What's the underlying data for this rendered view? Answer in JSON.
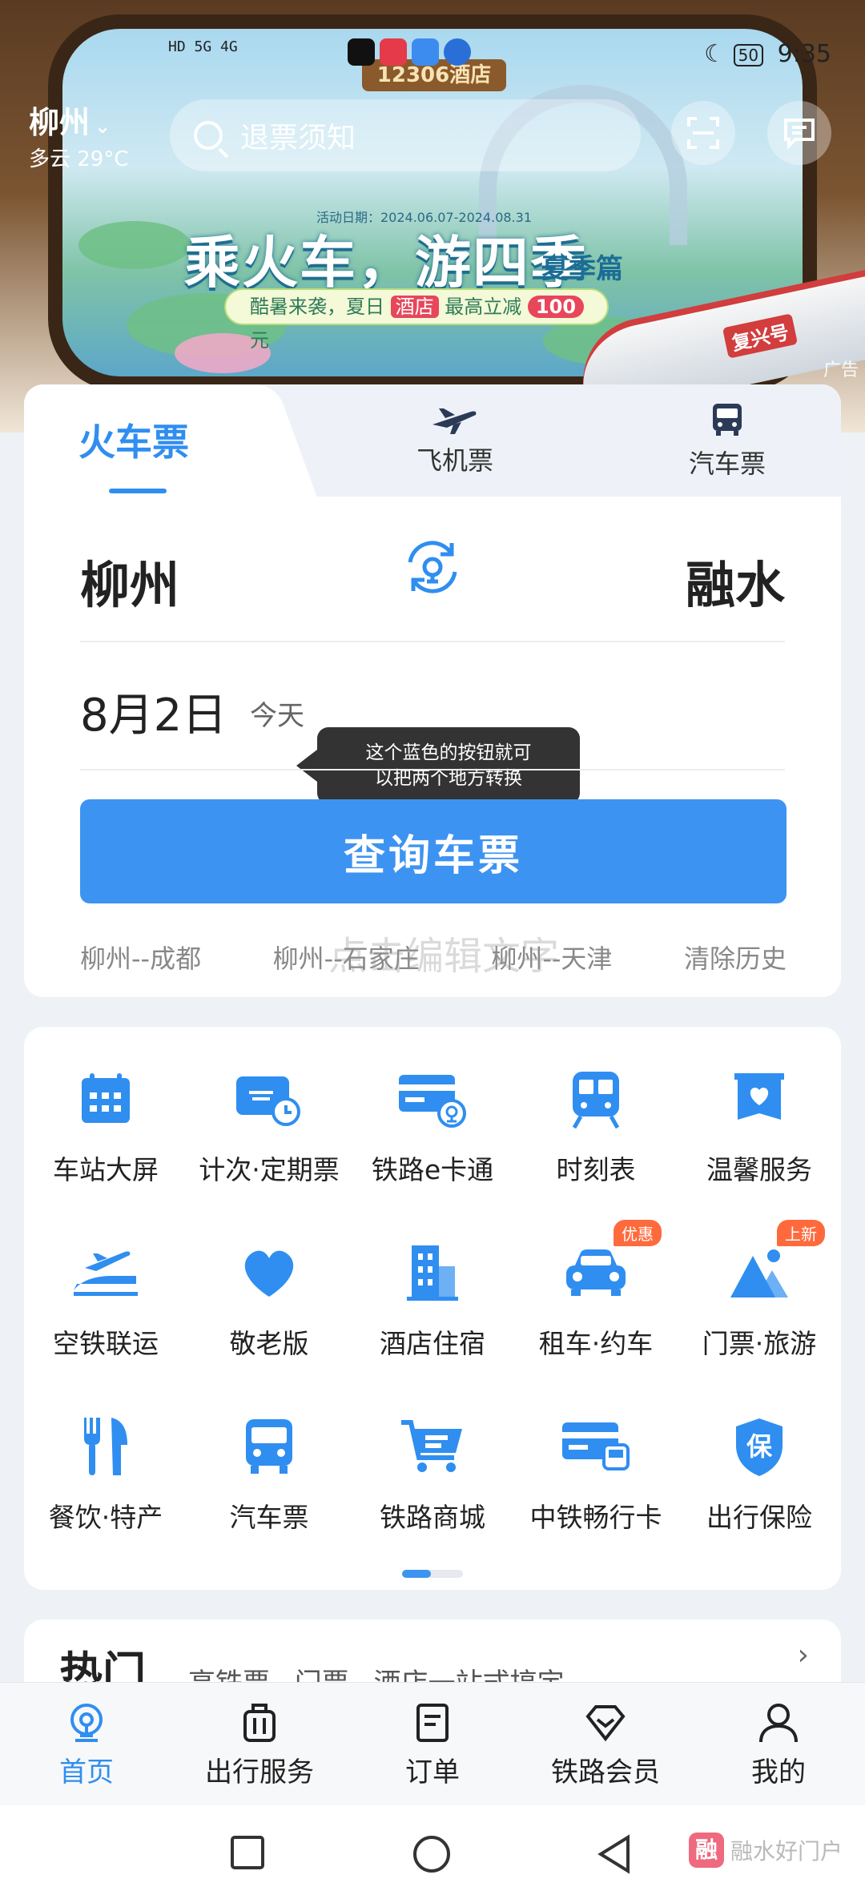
{
  "status_bar": {
    "signal": "HD 5G 4G",
    "time": "9:35",
    "battery": "50"
  },
  "header": {
    "city": "柳州",
    "weather": "多云 29°C",
    "search_placeholder": "退票须知"
  },
  "banner": {
    "sign": "12306酒店",
    "date_range": "活动日期：2024.06.07-2024.08.31",
    "title": "乘火车，游四季",
    "subtitle": "夏季篇",
    "pill_prefix": "酷暑来袭，夏日",
    "pill_hotel": "酒店",
    "pill_mid": "最高立减",
    "pill_amount": "100",
    "pill_unit": "元",
    "train_label": "复兴号",
    "ad_tag": "广告"
  },
  "tabs": {
    "train": "火车票",
    "flight": "飞机票",
    "bus": "汽车票"
  },
  "ticket": {
    "from": "柳州",
    "to": "融水",
    "date": "8月2日",
    "date_hint": "今天",
    "tooltip_line1": "这个蓝色的按钮就可",
    "tooltip_line2": "以把两个地方转换",
    "query_button": "查询车票",
    "history": [
      "柳州--成都",
      "柳州--石家庄",
      "柳州--天津",
      "清除历史"
    ],
    "watermark": "点击编辑文字"
  },
  "services": [
    {
      "label": "车站大屏",
      "icon": "calendar-icon"
    },
    {
      "label": "计次·定期票",
      "icon": "ticket-clock-icon"
    },
    {
      "label": "铁路e卡通",
      "icon": "rail-card-icon"
    },
    {
      "label": "时刻表",
      "icon": "train-front-icon"
    },
    {
      "label": "温馨服务",
      "icon": "heart-box-icon"
    },
    {
      "label": "空铁联运",
      "icon": "plane-train-icon"
    },
    {
      "label": "敬老版",
      "icon": "heart-icon"
    },
    {
      "label": "酒店住宿",
      "icon": "building-icon"
    },
    {
      "label": "租车·约车",
      "icon": "car-icon",
      "badge": "优惠"
    },
    {
      "label": "门票·旅游",
      "icon": "mountain-icon",
      "badge": "上新"
    },
    {
      "label": "餐饮·特产",
      "icon": "fork-knife-icon"
    },
    {
      "label": "汽车票",
      "icon": "bus-icon"
    },
    {
      "label": "铁路商城",
      "icon": "cart-icon"
    },
    {
      "label": "中铁畅行卡",
      "icon": "card-train-icon"
    },
    {
      "label": "出行保险",
      "icon": "shield-insurance-icon",
      "glyph": "保"
    }
  ],
  "hot": {
    "title": "热门",
    "tags": "高铁票 门票 酒店一站式搞定"
  },
  "bottom_nav": [
    {
      "label": "首页",
      "active": true
    },
    {
      "label": "出行服务"
    },
    {
      "label": "订单"
    },
    {
      "label": "铁路会员"
    },
    {
      "label": "我的"
    }
  ],
  "watermark_logo": {
    "glyph": "融",
    "text": "融水好门户"
  },
  "colors": {
    "accent": "#2f8ef0",
    "button": "#3d93f1",
    "badge": "#ff6a3d"
  }
}
